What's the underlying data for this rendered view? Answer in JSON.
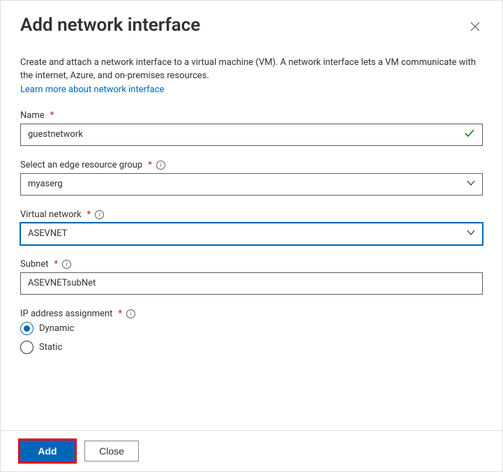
{
  "dialog": {
    "title": "Add network interface",
    "description": "Create and attach a network interface to a virtual machine (VM). A network interface lets a VM communicate with the internet, Azure, and on-premises resources.",
    "learn_link": "Learn more about network interface"
  },
  "fields": {
    "name": {
      "label": "Name",
      "value": "guestnetwork"
    },
    "rg": {
      "label": "Select an edge resource group",
      "value": "myaserg"
    },
    "vnet": {
      "label": "Virtual network",
      "value": "ASEVNET"
    },
    "subnet": {
      "label": "Subnet",
      "value": "ASEVNETsubNet"
    },
    "ip": {
      "label": "IP address assignment",
      "options": {
        "dynamic": "Dynamic",
        "static": "Static"
      },
      "selected": "dynamic"
    }
  },
  "buttons": {
    "add": "Add",
    "close": "Close"
  }
}
